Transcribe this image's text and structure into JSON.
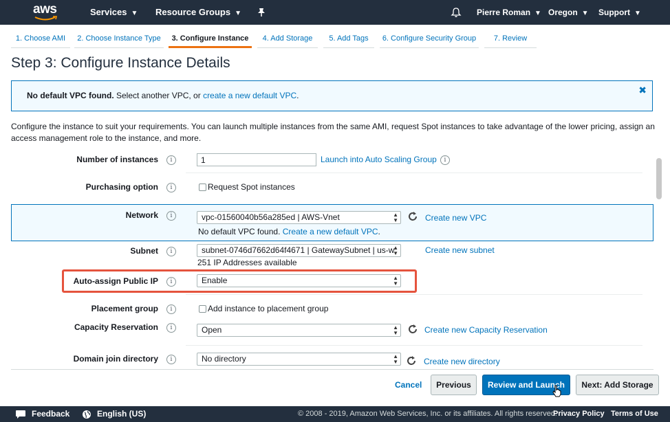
{
  "nav": {
    "logo_text": "aws",
    "services": "Services",
    "resource_groups": "Resource Groups",
    "user": "Pierre Roman",
    "region": "Oregon",
    "support": "Support"
  },
  "wizard_tabs": [
    {
      "label": "1. Choose AMI"
    },
    {
      "label": "2. Choose Instance Type"
    },
    {
      "label": "3. Configure Instance",
      "active": true
    },
    {
      "label": "4. Add Storage"
    },
    {
      "label": "5. Add Tags"
    },
    {
      "label": "6. Configure Security Group"
    },
    {
      "label": "7. Review"
    }
  ],
  "page_title": "Step 3: Configure Instance Details",
  "alert": {
    "bold": "No default VPC found.",
    "text": " Select another VPC, or ",
    "link": "create a new default VPC",
    "end": "."
  },
  "description": "Configure the instance to suit your requirements. You can launch multiple instances from the same AMI, request Spot instances to take advantage of the lower pricing, assign an access management role to the instance, and more.",
  "form": {
    "instances": {
      "label": "Number of instances",
      "value": "1",
      "link": "Launch into Auto Scaling Group"
    },
    "purchasing": {
      "label": "Purchasing option",
      "checkbox": "Request Spot instances"
    },
    "network": {
      "label": "Network",
      "value": "vpc-01560040b56a285ed | AWS-Vnet",
      "note_text": "No default VPC found.",
      "note_link": "Create a new default VPC",
      "note_end": ".",
      "action": "Create new VPC"
    },
    "subnet": {
      "label": "Subnet",
      "value": "subnet-0746d7662d64f4671 | GatewaySubnet | us-w",
      "note": "251 IP Addresses available",
      "action": "Create new subnet"
    },
    "public_ip": {
      "label": "Auto-assign Public IP",
      "value": "Enable"
    },
    "placement": {
      "label": "Placement group",
      "checkbox": "Add instance to placement group"
    },
    "capacity": {
      "label": "Capacity Reservation",
      "value": "Open",
      "action": "Create new Capacity Reservation"
    },
    "domain": {
      "label": "Domain join directory",
      "value": "No directory",
      "action": "Create new directory"
    }
  },
  "actions": {
    "cancel": "Cancel",
    "previous": "Previous",
    "review": "Review and Launch",
    "next": "Next: Add Storage"
  },
  "footer": {
    "feedback": "Feedback",
    "language": "English (US)",
    "copyright": "© 2008 - 2019, Amazon Web Services, Inc. or its affiliates. All rights reserved.",
    "privacy": "Privacy Policy",
    "terms": "Terms of Use"
  },
  "colors": {
    "nav_bg": "#232f3e",
    "link": "#0073bb",
    "accent": "#ec7211",
    "highlight": "#e5533d"
  }
}
